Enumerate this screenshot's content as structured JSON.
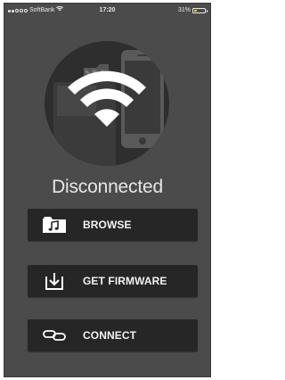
{
  "status_bar": {
    "carrier": "SoftBank",
    "time": "17:20",
    "battery": "31%",
    "battery_level": 0.31
  },
  "connection": {
    "status": "Disconnected"
  },
  "actions": {
    "browse_label": "BROWSE",
    "firmware_label": "GET FIRMWARE",
    "connect_label": "CONNECT"
  },
  "colors": {
    "background": "#4b4b4b",
    "button": "#262626",
    "circle": "#2e2e2e",
    "text": "#f2f2f2",
    "battery_fill": "#f3c53c"
  },
  "icons": {
    "hero": "wifi-devices-illustration",
    "browse": "music-folder-icon",
    "firmware": "download-icon",
    "connect": "link-icon"
  }
}
